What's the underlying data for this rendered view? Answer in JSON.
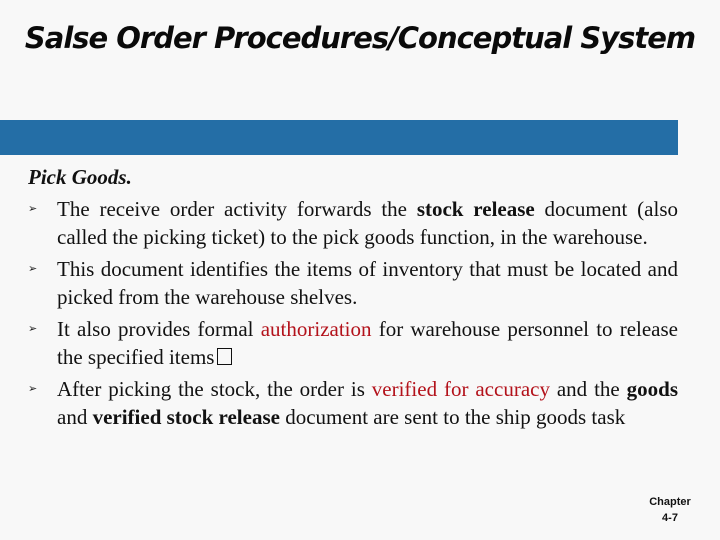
{
  "slide": {
    "title": "Salse Order Procedures/Conceptual System",
    "band_color": "#246ea6",
    "accent_color": "#b3121b"
  },
  "content": {
    "heading": "Pick Goods.",
    "bullet_icon": "arrowhead-bullet",
    "bullets": [
      {
        "segments": [
          {
            "text": "The receive order activity forwards the ",
            "style": "normal"
          },
          {
            "text": "stock release",
            "style": "bold"
          },
          {
            "text": " document (also called the picking ticket) to the pick goods function, in the warehouse.",
            "style": "normal"
          }
        ]
      },
      {
        "segments": [
          {
            "text": "This document identifies the items of inventory that must be located and picked from the warehouse shelves.",
            "style": "normal"
          }
        ]
      },
      {
        "segments": [
          {
            "text": "It also provides formal ",
            "style": "normal"
          },
          {
            "text": "authorization",
            "style": "red"
          },
          {
            "text": " for warehouse personnel to release the specified items",
            "style": "normal"
          }
        ],
        "trailing_icon": "missing-glyph-box"
      },
      {
        "segments": [
          {
            "text": "After picking the stock, the order is ",
            "style": "normal"
          },
          {
            "text": "verified for accuracy",
            "style": "red"
          },
          {
            "text": " and the ",
            "style": "normal"
          },
          {
            "text": "goods",
            "style": "bold"
          },
          {
            "text": " and ",
            "style": "normal"
          },
          {
            "text": "verified stock release",
            "style": "bold"
          },
          {
            "text": " document are sent to the ship goods task",
            "style": "normal"
          }
        ]
      }
    ]
  },
  "footer": {
    "chapter_label": "Chapter",
    "page_label": "4-7"
  }
}
